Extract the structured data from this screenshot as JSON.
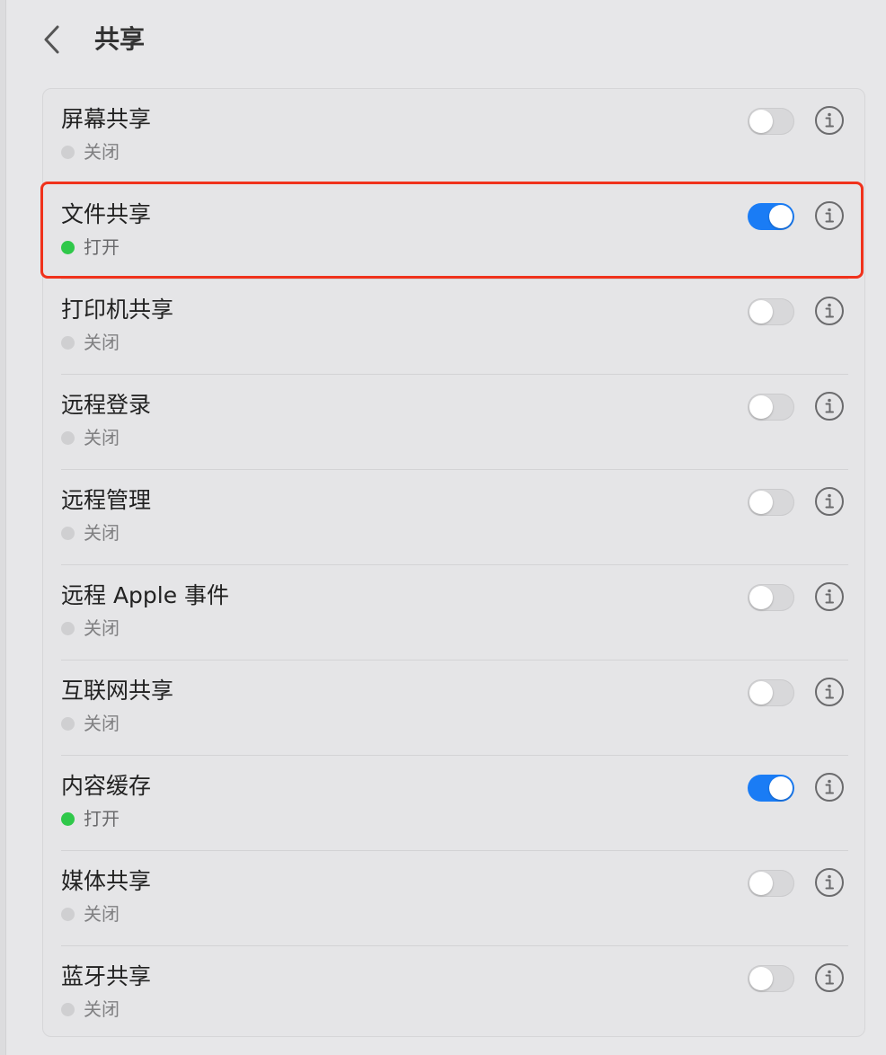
{
  "header": {
    "back_label": "back",
    "title": "共享"
  },
  "items": [
    {
      "name": "屏幕共享",
      "status": "关闭",
      "enabled": false
    },
    {
      "name": "文件共享",
      "status": "打开",
      "enabled": true
    },
    {
      "name": "打印机共享",
      "status": "关闭",
      "enabled": false
    },
    {
      "name": "远程登录",
      "status": "关闭",
      "enabled": false
    },
    {
      "name": "远程管理",
      "status": "关闭",
      "enabled": false
    },
    {
      "name": "远程 Apple 事件",
      "status": "关闭",
      "enabled": false
    },
    {
      "name": "互联网共享",
      "status": "关闭",
      "enabled": false
    },
    {
      "name": "内容缓存",
      "status": "打开",
      "enabled": true
    },
    {
      "name": "媒体共享",
      "status": "关闭",
      "enabled": false
    },
    {
      "name": "蓝牙共享",
      "status": "关闭",
      "enabled": false
    }
  ],
  "colors": {
    "accent": "#1a7cf5",
    "status_on": "#2fc84a",
    "status_off": "#cfcfd1",
    "highlight": "#f0321c"
  },
  "icons": {
    "back": "chevron-left-icon",
    "info": "info-circle-icon"
  },
  "highlighted_item": "文件共享"
}
